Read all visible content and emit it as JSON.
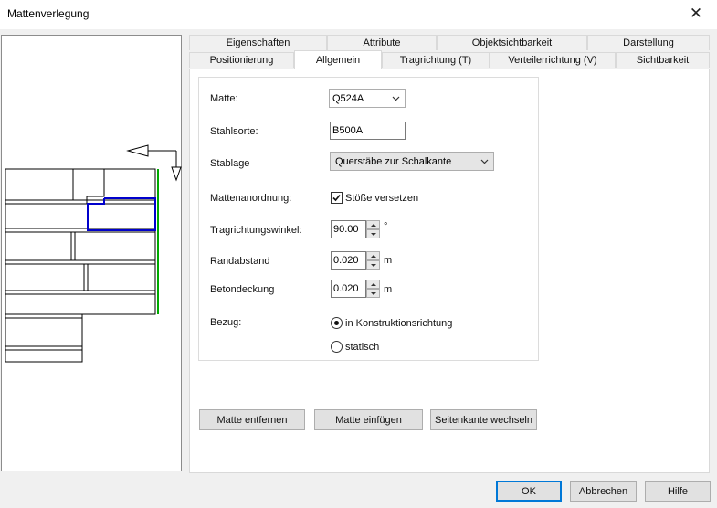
{
  "window": {
    "title": "Mattenverlegung",
    "close_label": "✕"
  },
  "tabs": {
    "row_back": [
      "Eigenschaften",
      "Attribute",
      "Objektsichtbarkeit",
      "Darstellung"
    ],
    "row_front": [
      "Positionierung",
      "Allgemein",
      "Tragrichtung (T)",
      "Verteilerrichtung (V)",
      "Sichtbarkeit"
    ],
    "active": "Allgemein"
  },
  "form": {
    "matte": {
      "label": "Matte:",
      "value": "Q524A"
    },
    "stahlsorte": {
      "label": "Stahlsorte:",
      "value": "B500A"
    },
    "stablage": {
      "label": "Stablage",
      "value": "Querstäbe zur Schalkante"
    },
    "mattenanordnung": {
      "label": "Mattenanordnung:",
      "checkbox_label": "Stöße versetzen",
      "checked": true
    },
    "tragrichtungswinkel": {
      "label": "Tragrichtungswinkel:",
      "value": "90.00",
      "unit": "°"
    },
    "randabstand": {
      "label": "Randabstand",
      "value": "0.020",
      "unit": "m"
    },
    "betondeckung": {
      "label": "Betondeckung",
      "value": "0.020",
      "unit": "m"
    },
    "bezug": {
      "label": "Bezug:",
      "options": [
        "in Konstruktionsrichtung",
        "statisch"
      ],
      "selected": "in Konstruktionsrichtung"
    }
  },
  "actions": {
    "remove": "Matte entfernen",
    "insert": "Matte einfügen",
    "switch_edge": "Seitenkante wechseln"
  },
  "footer": {
    "ok": "OK",
    "cancel": "Abbrechen",
    "help": "Hilfe"
  },
  "colors": {
    "accent": "#0078d7",
    "selected_mat": "#0000cc",
    "edge": "#00aa00"
  }
}
